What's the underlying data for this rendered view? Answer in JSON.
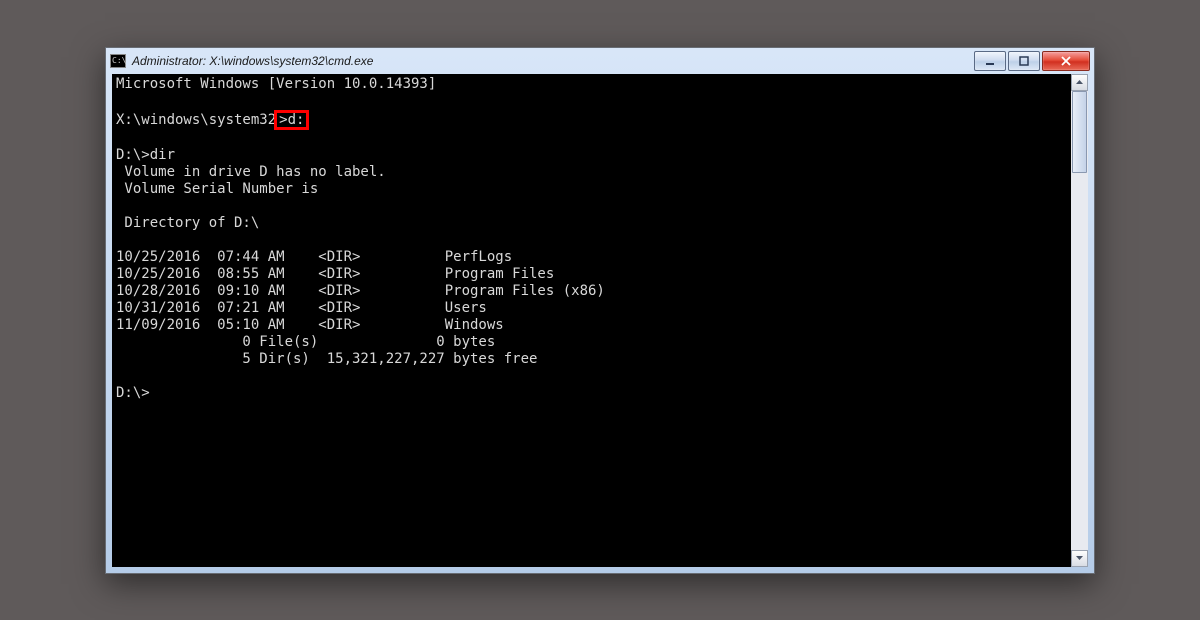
{
  "window": {
    "title": "Administrator: X:\\windows\\system32\\cmd.exe",
    "icon_glyph": "C:\\"
  },
  "terminal": {
    "line_version": "Microsoft Windows [Version 10.0.14393]",
    "prompt1_path": "X:\\windows\\system32",
    "prompt1_gt": ">",
    "prompt1_cmd": "d:",
    "prompt2": "D:\\>dir",
    "vol1": " Volume in drive D has no label.",
    "vol2": " Volume Serial Number is",
    "dirhdr": " Directory of D:\\",
    "rows": [
      "10/25/2016  07:44 AM    <DIR>          PerfLogs",
      "10/25/2016  08:55 AM    <DIR>          Program Files",
      "10/28/2016  09:10 AM    <DIR>          Program Files (x86)",
      "10/31/2016  07:21 AM    <DIR>          Users",
      "11/09/2016  05:10 AM    <DIR>          Windows"
    ],
    "summary1": "               0 File(s)              0 bytes",
    "summary2": "               5 Dir(s)  15,321,227,227 bytes free",
    "prompt3": "D:\\>"
  }
}
